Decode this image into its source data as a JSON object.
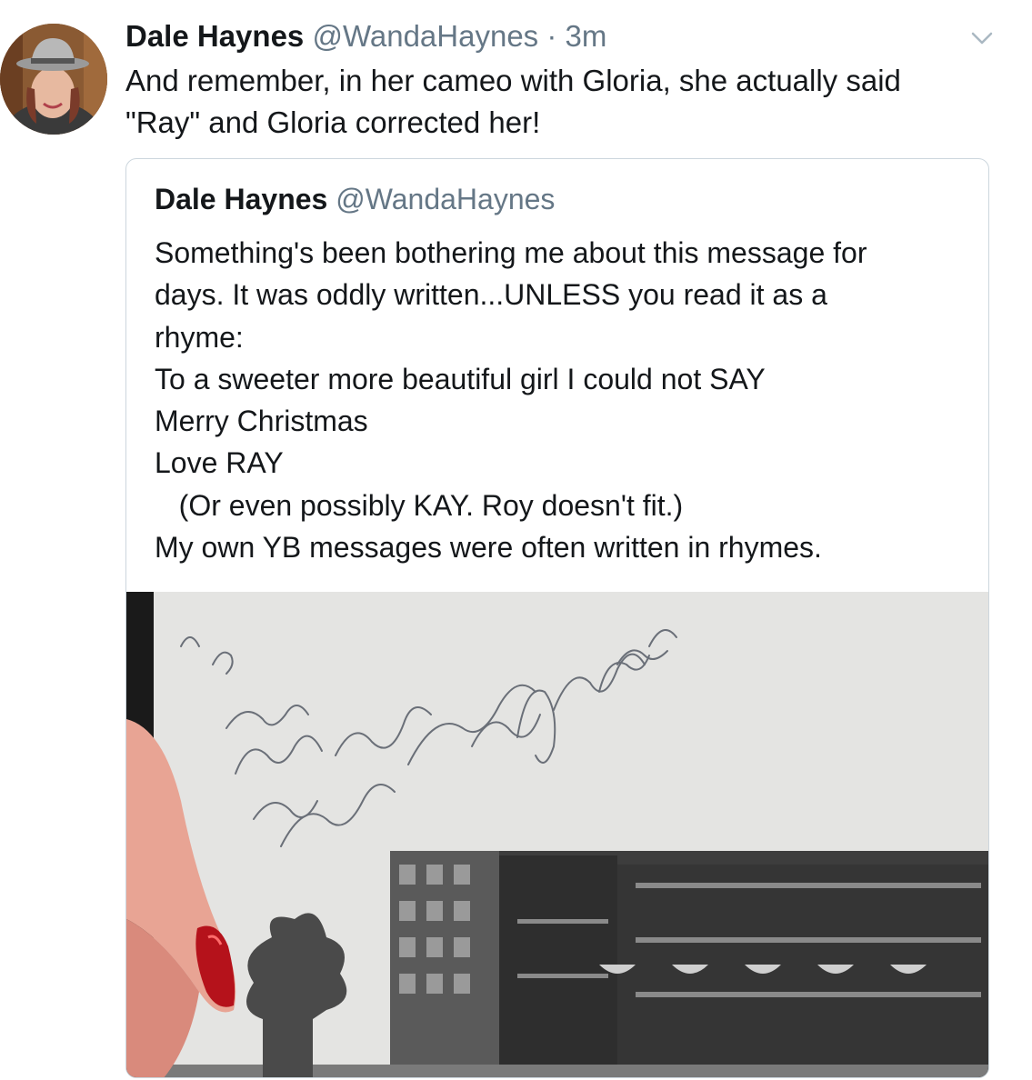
{
  "tweet": {
    "author_name": "Dale Haynes",
    "author_handle": "@WandaHaynes",
    "separator": "·",
    "time": "3m",
    "text_lines": [
      "And remember, in her cameo with Gloria, she actually said",
      "\"Ray\" and Gloria corrected her!"
    ],
    "menu_icon": "chevron-down-icon"
  },
  "quoted_tweet": {
    "author_name": "Dale Haynes",
    "author_handle": "@WandaHaynes",
    "lines": [
      "Something's been bothering me about this message for",
      "days. It was oddly written...UNLESS you read it as a",
      "rhyme:",
      "To a sweeter more beautiful girl I could not SAY",
      "Merry Christmas",
      "Love RAY",
      "   (Or even possibly KAY. Roy doesn't fit.)",
      "My own YB messages were often written in rhymes."
    ]
  },
  "colors": {
    "text": "#14171a",
    "secondary": "#657786",
    "border": "#ccd6dd"
  }
}
